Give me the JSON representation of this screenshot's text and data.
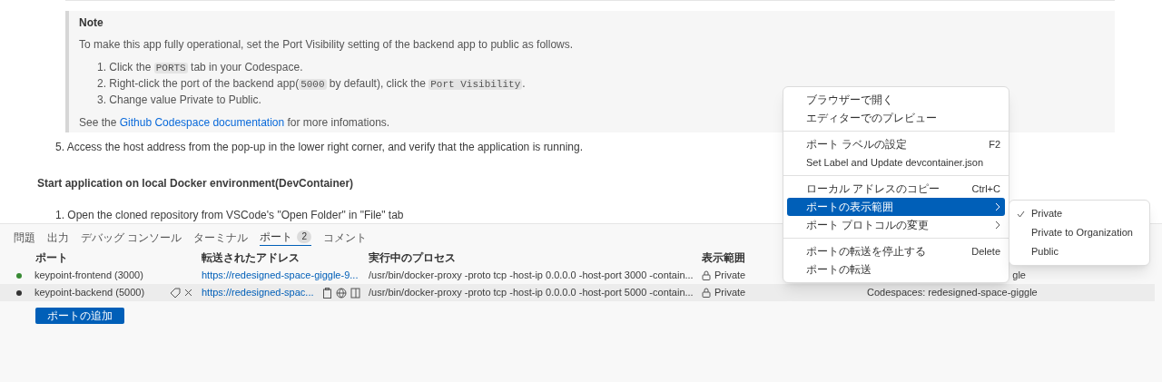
{
  "doc": {
    "note": {
      "title": "Note",
      "intro": "To make this app fully operational, set the Port Visibility setting of the backend app to public as follows.",
      "steps": [
        [
          {
            "t": "1. Click the "
          },
          {
            "code": "PORTS"
          },
          {
            "t": " tab in your Codespace."
          }
        ],
        [
          {
            "t": "2. Right-click the port of the backend app("
          },
          {
            "code": "5000"
          },
          {
            "t": " by default), click the "
          },
          {
            "code": "Port Visibility"
          },
          {
            "t": "."
          }
        ],
        [
          {
            "t": "3. Change value Private to Public."
          }
        ]
      ],
      "see": {
        "before": "See the ",
        "link": "Github Codespace documentation",
        "after": " for more infomations."
      }
    },
    "step5": "5. Access the host address from the pop-up in the lower right corner, and verify that the application is running.",
    "heading": "Start application on local Docker environment(DevContainer)",
    "step1": "1. Open the cloned repository from VSCode's \"Open Folder\" in \"File\" tab"
  },
  "panel": {
    "tabs": [
      {
        "label": "問題",
        "selected": false
      },
      {
        "label": "出力",
        "selected": false
      },
      {
        "label": "デバッグ コンソール",
        "selected": false
      },
      {
        "label": "ターミナル",
        "selected": false
      },
      {
        "label": "ポート",
        "selected": true,
        "badge": "2"
      },
      {
        "label": "コメント",
        "selected": false
      }
    ],
    "columns": [
      "ポート",
      "転送されたアドレス",
      "実行中のプロセス",
      "表示範囲"
    ],
    "rows": [
      {
        "color": "#388a34",
        "port": "keypoint-frontend (3000)",
        "address": "https://redesigned-space-giggle-9...",
        "process": "/usr/bin/docker-proxy -proto tcp -host-ip 0.0.0.0 -host-port 3000 -contain...",
        "visibility": "Private",
        "origin": "gle",
        "selected": false
      },
      {
        "color": "#333333",
        "port": "keypoint-backend (5000)",
        "address": "https://redesigned-spac...",
        "process": "/usr/bin/docker-proxy -proto tcp -host-ip 0.0.0.0 -host-port 5000 -contain...",
        "visibility": "Private",
        "origin": "Codespaces: redesigned-space-giggle",
        "selected": true
      }
    ],
    "add_button": "ポートの追加"
  },
  "context_menu": {
    "items": [
      {
        "kind": "item",
        "label": "ブラウザーで開く",
        "selected": false
      },
      {
        "kind": "item",
        "label": "エディターでのプレビュー",
        "selected": false
      },
      {
        "kind": "separator"
      },
      {
        "kind": "item",
        "label": "ポート ラベルの設定",
        "shortcut": "F2",
        "selected": false
      },
      {
        "kind": "item",
        "label": "Set Label and Update devcontainer.json",
        "selected": false
      },
      {
        "kind": "separator"
      },
      {
        "kind": "item",
        "label": "ローカル アドレスのコピー",
        "shortcut": "Ctrl+C",
        "selected": false
      },
      {
        "kind": "submenu",
        "label": "ポートの表示範囲",
        "selected": true
      },
      {
        "kind": "submenu",
        "label": "ポート プロトコルの変更",
        "selected": false
      },
      {
        "kind": "separator"
      },
      {
        "kind": "item",
        "label": "ポートの転送を停止する",
        "shortcut": "Delete",
        "selected": false
      },
      {
        "kind": "item",
        "label": "ポートの転送",
        "selected": false
      }
    ],
    "submenu": [
      {
        "label": "Private",
        "checked": true
      },
      {
        "label": "Private to Organization",
        "checked": false
      },
      {
        "label": "Public",
        "checked": false
      }
    ]
  }
}
